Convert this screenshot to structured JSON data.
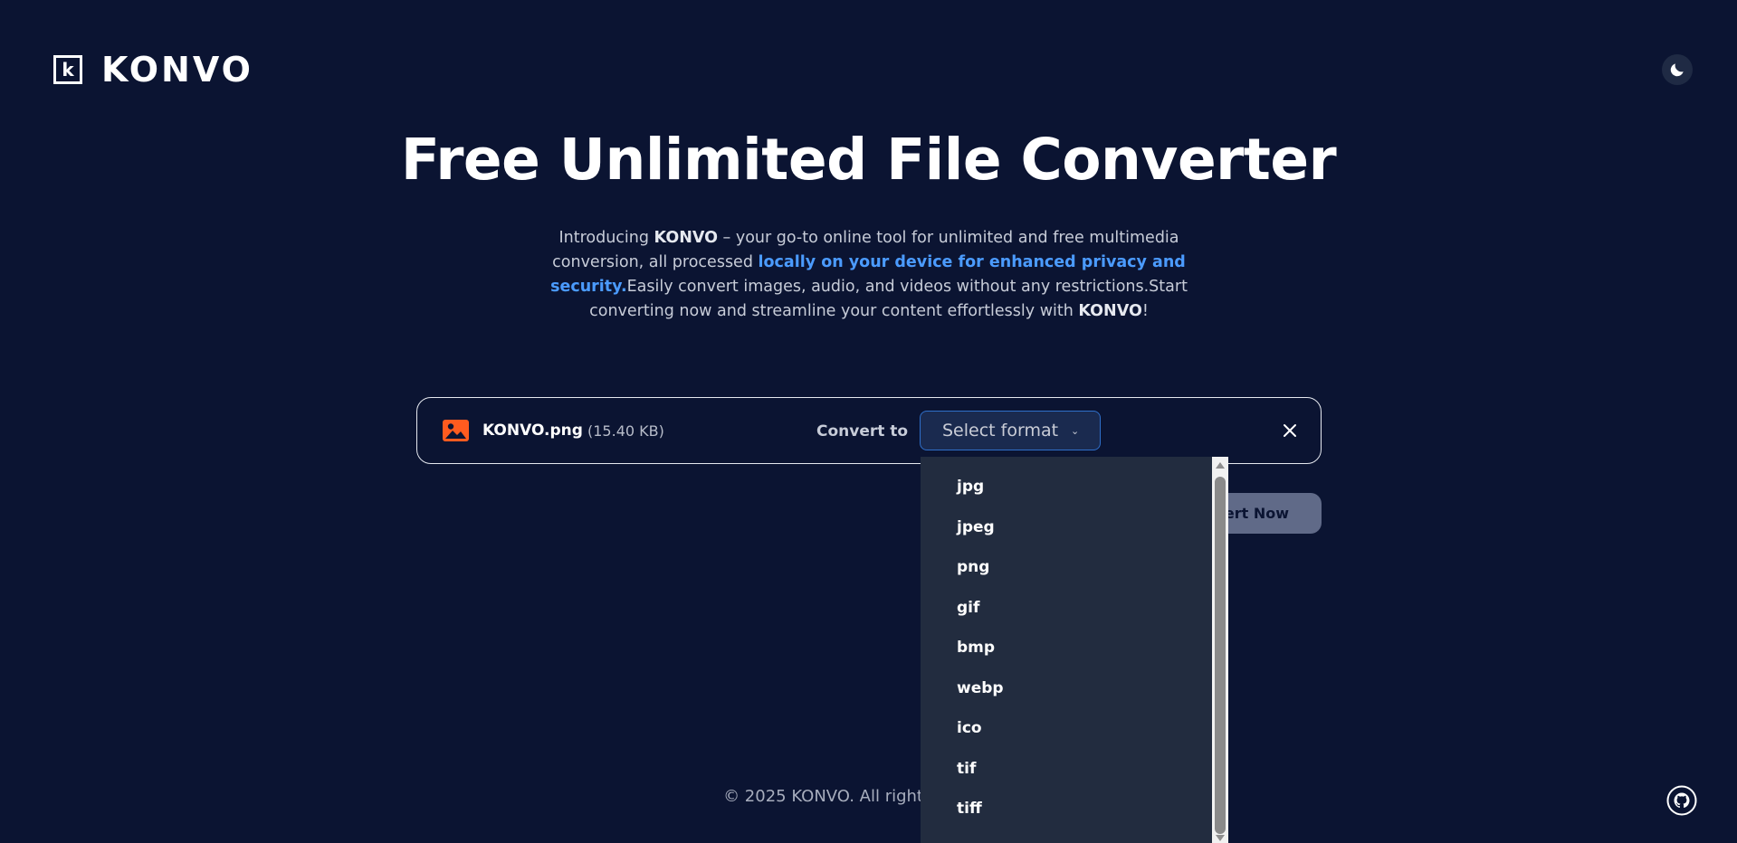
{
  "header": {
    "brand": "KONVO",
    "logo_letter": "k",
    "theme_toggle_icon": "moon-icon"
  },
  "hero": {
    "title": "Free Unlimited File Converter",
    "intro": {
      "p1": "Introducing ",
      "brand1": "KONVO",
      "p2": " – your go-to online tool for unlimited and free multimedia conversion, all processed ",
      "highlight": "locally on your device for enhanced privacy and security.",
      "p3": "Easily convert images, audio, and videos without any restrictions.Start converting now and streamline your content effortlessly with ",
      "brand2": "KONVO",
      "p4": "!"
    }
  },
  "file_card": {
    "file_icon": "image-icon",
    "file_name": "KONVO.png",
    "file_size": "(15.40 KB)",
    "convert_to_label": "Convert to",
    "select_placeholder": "Select format",
    "close_icon": "close-icon"
  },
  "actions": {
    "convert_now_label": "Convert Now"
  },
  "format_dropdown": {
    "options": [
      "jpg",
      "jpeg",
      "png",
      "gif",
      "bmp",
      "webp",
      "ico",
      "tif",
      "tiff"
    ]
  },
  "footer": {
    "copyright": "© 2025 KONVO. All rights reserved.",
    "github_icon": "github-icon"
  },
  "colors": {
    "background": "#0b1432",
    "highlight_blue": "#4b9bff",
    "dropdown_bg": "#222c3f",
    "convert_button_bg": "#606a88",
    "file_icon_orange": "#ff5b1f"
  }
}
